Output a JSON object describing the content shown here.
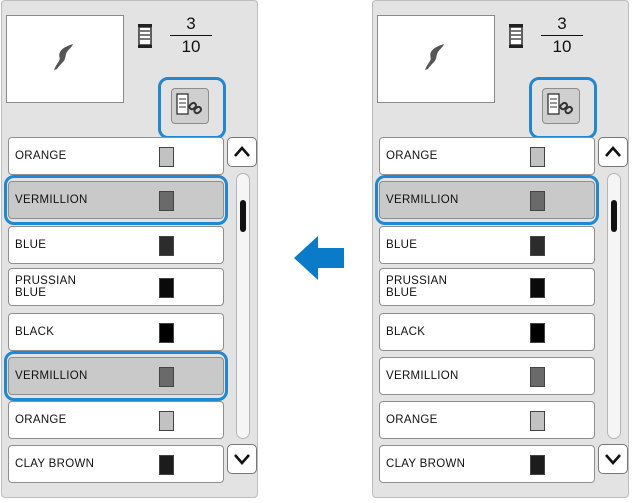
{
  "counter": {
    "current": "3",
    "total": "10"
  },
  "colors": {
    "accent": "#1e88d6",
    "arrow": "#0a7bc9",
    "panel": "#e3e3e3",
    "selected_row": "#c9c9c9"
  },
  "icons": {
    "preview": "embroidery-preview",
    "spool": "thread-spool-icon",
    "link": "linked-thread-icon",
    "up": "chevron-up-icon",
    "down": "chevron-down-icon",
    "transition": "left-arrow-icon"
  },
  "before": {
    "items": [
      {
        "label": "ORANGE",
        "swatch": "#c2c2c2",
        "selected": false
      },
      {
        "label": "VERMILLION",
        "swatch": "#6a6a6a",
        "selected": true
      },
      {
        "label": "BLUE",
        "swatch": "#2c2c2c",
        "selected": false
      },
      {
        "label": "PRUSSIAN\nBLUE",
        "swatch": "#0a0a0a",
        "selected": false
      },
      {
        "label": "BLACK",
        "swatch": "#000000",
        "selected": false
      },
      {
        "label": "VERMILLION",
        "swatch": "#6a6a6a",
        "selected": true
      },
      {
        "label": "ORANGE",
        "swatch": "#c2c2c2",
        "selected": false
      },
      {
        "label": "CLAY BROWN",
        "swatch": "#1c1c1c",
        "selected": false
      }
    ]
  },
  "after": {
    "items": [
      {
        "label": "ORANGE",
        "swatch": "#c2c2c2",
        "selected": false
      },
      {
        "label": "VERMILLION",
        "swatch": "#6a6a6a",
        "selected": true
      },
      {
        "label": "BLUE",
        "swatch": "#2c2c2c",
        "selected": false
      },
      {
        "label": "PRUSSIAN\nBLUE",
        "swatch": "#0a0a0a",
        "selected": false
      },
      {
        "label": "BLACK",
        "swatch": "#000000",
        "selected": false
      },
      {
        "label": "VERMILLION",
        "swatch": "#6a6a6a",
        "selected": false
      },
      {
        "label": "ORANGE",
        "swatch": "#c2c2c2",
        "selected": false
      },
      {
        "label": "CLAY BROWN",
        "swatch": "#1c1c1c",
        "selected": false
      }
    ]
  }
}
